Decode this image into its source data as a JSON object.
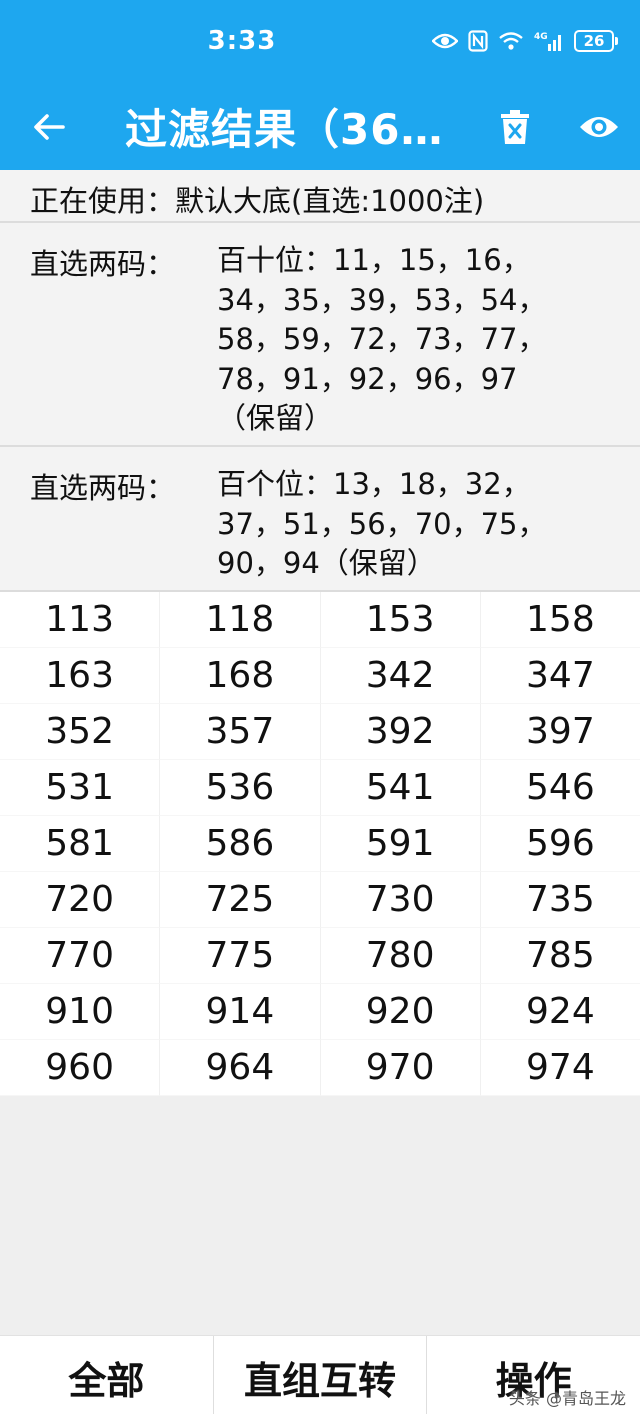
{
  "status_bar": {
    "time": "3:33",
    "icons": [
      "eye-icon",
      "nfc-icon",
      "wifi-icon",
      "4g-signal-icon"
    ],
    "network_label": "4G",
    "battery": "26"
  },
  "app_bar": {
    "title": "过滤结果（36…",
    "back_icon": "arrow-left-icon",
    "delete_icon": "trash-icon",
    "view_icon": "eye-icon",
    "color": "#1ea7ef"
  },
  "in_use": "正在使用：默认大底(直选:1000注)",
  "filters": [
    {
      "label": "直选两码：",
      "lines": [
        "百十位：11，15，16，",
        "34，35，39，53，54，",
        "58，59，72，73，77，",
        "78，91，92，96，97",
        "（保留）"
      ]
    },
    {
      "label": "直选两码：",
      "lines": [
        "百个位：13，18，32，",
        "37，51，56，70，75，",
        "90，94（保留）"
      ]
    }
  ],
  "results": [
    [
      "113",
      "118",
      "153",
      "158"
    ],
    [
      "163",
      "168",
      "342",
      "347"
    ],
    [
      "352",
      "357",
      "392",
      "397"
    ],
    [
      "531",
      "536",
      "541",
      "546"
    ],
    [
      "581",
      "586",
      "591",
      "596"
    ],
    [
      "720",
      "725",
      "730",
      "735"
    ],
    [
      "770",
      "775",
      "780",
      "785"
    ],
    [
      "910",
      "914",
      "920",
      "924"
    ],
    [
      "960",
      "964",
      "970",
      "974"
    ]
  ],
  "bottom_tabs": [
    "全部",
    "直组互转",
    "操作"
  ],
  "watermark": "头条 @青岛王龙"
}
